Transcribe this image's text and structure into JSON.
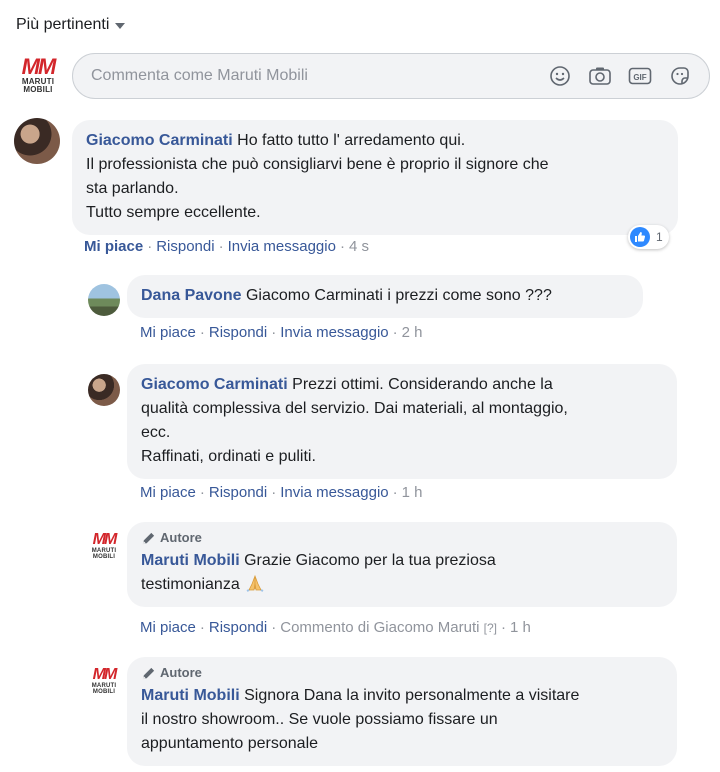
{
  "sort_label": "Più pertinenti",
  "page": {
    "logo_mark": "MM",
    "logo_text": "MARUTI MOBILI"
  },
  "composer": {
    "placeholder": "Commenta come Maruti Mobili"
  },
  "icons": {
    "emoji": "smiley-icon",
    "camera": "camera-icon",
    "gif": "gif-icon",
    "sticker": "sticker-icon"
  },
  "comments": [
    {
      "author": "Giacomo Carminati",
      "lines": [
        "Ho fatto tutto l' arredamento qui.",
        "Il professionista che può consigliarvi bene è proprio il signore che",
        "sta parlando.",
        "Tutto sempre eccellente."
      ],
      "actions": {
        "like": "Mi piace",
        "reply": "Rispondi",
        "message": "Invia messaggio",
        "time": "4 s"
      },
      "reaction_count": "1"
    },
    {
      "author": "Dana Pavone",
      "lines": [
        "Giacomo Carminati i prezzi come sono ???"
      ],
      "actions": {
        "like": "Mi piace",
        "reply": "Rispondi",
        "message": "Invia messaggio",
        "time": "2 h"
      }
    },
    {
      "author": "Giacomo Carminati",
      "lines": [
        "Prezzi ottimi. Considerando anche la",
        "qualità complessiva del servizio. Dai materiali, al montaggio,",
        "ecc.",
        "Raffinati, ordinati e puliti."
      ],
      "actions": {
        "like": "Mi piace",
        "reply": "Rispondi",
        "message": "Invia messaggio",
        "time": "1 h"
      }
    },
    {
      "badge": "Autore",
      "author": "Maruti Mobili",
      "lines": [
        "Grazie Giacomo per la tua preziosa",
        "testimonianza"
      ],
      "emoji": "folded-hands",
      "actions": {
        "like": "Mi piace",
        "reply": "Rispondi",
        "commented_by": "Commento di Giacomo Maruti",
        "help": "[?]",
        "time": "1 h"
      }
    },
    {
      "badge": "Autore",
      "author": "Maruti Mobili",
      "lines": [
        "Signora Dana la invito personalmente a visitare",
        "il nostro showroom.. Se vuole possiamo fissare un",
        "appuntamento personale"
      ]
    }
  ],
  "sep": "·"
}
